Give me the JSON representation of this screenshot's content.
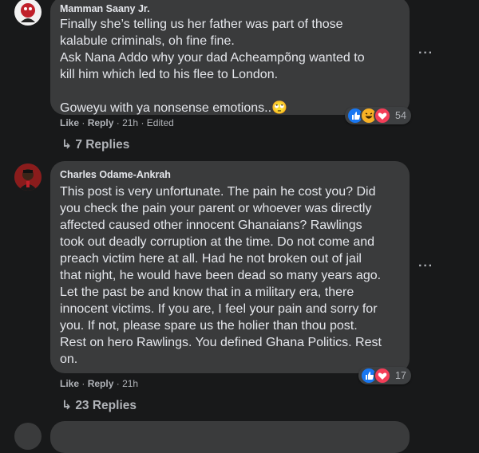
{
  "comments": [
    {
      "author": "Mamman Saany Jr.",
      "text": "Finally she’s telling us her father was part of those\nkalabule criminals, oh fine fine.\nAsk Nana Addo why your dad Acheampõng wanted to\nkill him which led to his flee to London.\n\nGoweyu with ya nonsense emotions..🙄",
      "reaction_count": "54",
      "reactions": [
        "like",
        "haha",
        "love"
      ],
      "actions": {
        "like": "Like",
        "reply": "Reply",
        "time": "21h",
        "edited": "Edited"
      },
      "replies": "7 Replies"
    },
    {
      "author": "Charles Odame-Ankrah",
      "text": "This post is very unfortunate. The pain he cost you? Did\nyou check the pain your parent or whoever was directly\naffected caused other innocent Ghanaians? Rawlings\ntook out deadly corruption at the time. Do not come and\npreach victim here at all. Had he not broken out of jail\nthat night, he would have been dead so many years ago.\nLet the past be and know that in a military era, there\ninnocent victims. If you are, I feel your pain and sorry for\nyou. If not, please spare us the holier than thou post.\nRest on hero Rawlings. You defined Ghana Politics. Rest\non.",
      "reaction_count": "17",
      "reactions": [
        "like",
        "love"
      ],
      "actions": {
        "like": "Like",
        "reply": "Reply",
        "time": "21h"
      },
      "replies": "23 Replies"
    }
  ],
  "ui": {
    "more_label": "···",
    "dot": "·",
    "reply_arrow": "↳"
  },
  "colors": {
    "background": "#18191a",
    "bubble": "#3a3b3c",
    "like_blue": "#1877f2",
    "love_red": "#f33e58",
    "haha_yellow": "#f7b125"
  }
}
